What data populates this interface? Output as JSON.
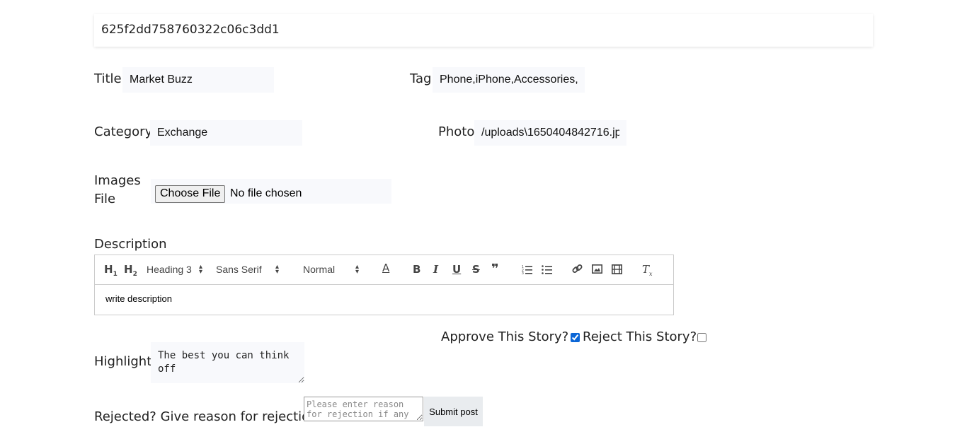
{
  "post_id": "625f2dd758760322c06c3dd1",
  "title": {
    "label": "Title",
    "value": "Market Buzz"
  },
  "tag": {
    "label": "Tag",
    "value": "Phone,iPhone,Accessories,"
  },
  "category": {
    "label": "Category",
    "value": "Exchange"
  },
  "photo": {
    "label": "Photo",
    "value": "/uploads\\1650404842716.jp"
  },
  "images": {
    "label_line1": "Images",
    "label_line2": "File",
    "button": "Choose File",
    "status": "No file chosen"
  },
  "description": {
    "label": "Description",
    "toolbar": {
      "h1": "H1",
      "h2": "H2",
      "header_select": "Heading 3",
      "font_select": "Sans Serif",
      "size_select": "Normal",
      "icons": [
        "header-1-icon",
        "header-2-icon",
        "text-color-icon",
        "bold-icon",
        "italic-icon",
        "underline-icon",
        "strike-icon",
        "blockquote-icon",
        "ordered-list-icon",
        "bullet-list-icon",
        "link-icon",
        "image-icon",
        "video-icon",
        "clean-format-icon"
      ]
    },
    "content": "write description"
  },
  "approve": {
    "label": "Approve This Story?",
    "checked": true
  },
  "reject": {
    "label": "Reject This Story?",
    "checked": false
  },
  "highlight": {
    "label": "Highlight",
    "value": "The best you can think off"
  },
  "rejection": {
    "label": "Rejected? Give reason for rejection",
    "placeholder": "Please enter reason for rejection if any"
  },
  "submit_label": "Submit post"
}
